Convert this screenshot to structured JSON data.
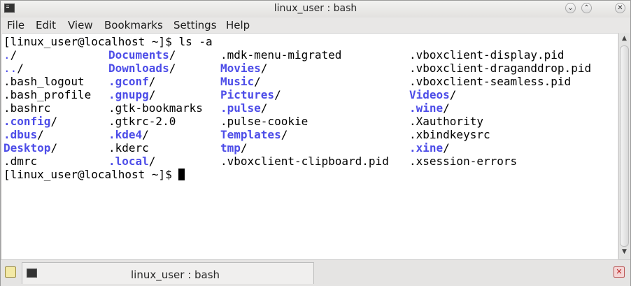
{
  "window": {
    "title": "linux_user : bash"
  },
  "menubar": {
    "items": [
      "File",
      "Edit",
      "View",
      "Bookmarks",
      "Settings",
      "Help"
    ]
  },
  "terminal": {
    "prompt": "[linux_user@localhost ~]$ ",
    "command": "ls -a",
    "rows": [
      [
        {
          "t": ".",
          "k": "dir"
        },
        {
          "t": "/",
          "k": "n"
        }
      ],
      [
        {
          "t": "..",
          "k": "dir"
        },
        {
          "t": "/",
          "k": "n"
        }
      ],
      [
        {
          "t": ".bash_logout",
          "k": "n"
        }
      ],
      [
        {
          "t": ".bash_profile",
          "k": "n"
        }
      ],
      [
        {
          "t": ".bashrc",
          "k": "n"
        }
      ],
      [
        {
          "t": ".config",
          "k": "hidden"
        },
        {
          "t": "/",
          "k": "n"
        }
      ],
      [
        {
          "t": ".dbus",
          "k": "hidden"
        },
        {
          "t": "/",
          "k": "n"
        }
      ],
      [
        {
          "t": "Desktop",
          "k": "hidden"
        },
        {
          "t": "/",
          "k": "n"
        }
      ],
      [
        {
          "t": ".dmrc",
          "k": "n"
        }
      ]
    ],
    "col2": [
      [
        {
          "t": "Documents",
          "k": "hidden"
        },
        {
          "t": "/",
          "k": "n"
        }
      ],
      [
        {
          "t": "Downloads",
          "k": "hidden"
        },
        {
          "t": "/",
          "k": "n"
        }
      ],
      [
        {
          "t": ".gconf",
          "k": "hidden"
        },
        {
          "t": "/",
          "k": "n"
        }
      ],
      [
        {
          "t": ".gnupg",
          "k": "hidden"
        },
        {
          "t": "/",
          "k": "n"
        }
      ],
      [
        {
          "t": ".gtk-bookmarks",
          "k": "n"
        }
      ],
      [
        {
          "t": ".gtkrc-2.0",
          "k": "n"
        }
      ],
      [
        {
          "t": ".kde4",
          "k": "hidden"
        },
        {
          "t": "/",
          "k": "n"
        }
      ],
      [
        {
          "t": ".kderc",
          "k": "n"
        }
      ],
      [
        {
          "t": ".local",
          "k": "hidden"
        },
        {
          "t": "/",
          "k": "n"
        }
      ]
    ],
    "col3": [
      [
        {
          "t": ".mdk-menu-migrated",
          "k": "n"
        }
      ],
      [
        {
          "t": "Movies",
          "k": "hidden"
        },
        {
          "t": "/",
          "k": "n"
        }
      ],
      [
        {
          "t": "Music",
          "k": "hidden"
        },
        {
          "t": "/",
          "k": "n"
        }
      ],
      [
        {
          "t": "Pictures",
          "k": "hidden"
        },
        {
          "t": "/",
          "k": "n"
        }
      ],
      [
        {
          "t": ".pulse",
          "k": "hidden"
        },
        {
          "t": "/",
          "k": "n"
        }
      ],
      [
        {
          "t": ".pulse-cookie",
          "k": "n"
        }
      ],
      [
        {
          "t": "Templates",
          "k": "hidden"
        },
        {
          "t": "/",
          "k": "n"
        }
      ],
      [
        {
          "t": "tmp",
          "k": "hidden"
        },
        {
          "t": "/",
          "k": "n"
        }
      ],
      [
        {
          "t": ".vboxclient-clipboard.pid",
          "k": "n"
        }
      ]
    ],
    "col4": [
      [
        {
          "t": ".vboxclient-display.pid",
          "k": "n"
        }
      ],
      [
        {
          "t": ".vboxclient-draganddrop.pid",
          "k": "n"
        }
      ],
      [
        {
          "t": ".vboxclient-seamless.pid",
          "k": "n"
        }
      ],
      [
        {
          "t": "Videos",
          "k": "hidden"
        },
        {
          "t": "/",
          "k": "n"
        }
      ],
      [
        {
          "t": ".wine",
          "k": "hidden"
        },
        {
          "t": "/",
          "k": "n"
        }
      ],
      [
        {
          "t": ".Xauthority",
          "k": "n"
        }
      ],
      [
        {
          "t": ".xbindkeysrc",
          "k": "n"
        }
      ],
      [
        {
          "t": ".xine",
          "k": "hidden"
        },
        {
          "t": "/",
          "k": "n"
        }
      ],
      [
        {
          "t": ".xsession-errors",
          "k": "n"
        }
      ]
    ]
  },
  "tab": {
    "label": "linux_user : bash"
  },
  "icons": {
    "app": "terminal-icon",
    "minimize": "chevron-down-icon",
    "maximize": "chevron-up-icon",
    "close": "close-icon",
    "new_tab": "new-tab-icon",
    "close_tab": "close-tab-icon"
  }
}
